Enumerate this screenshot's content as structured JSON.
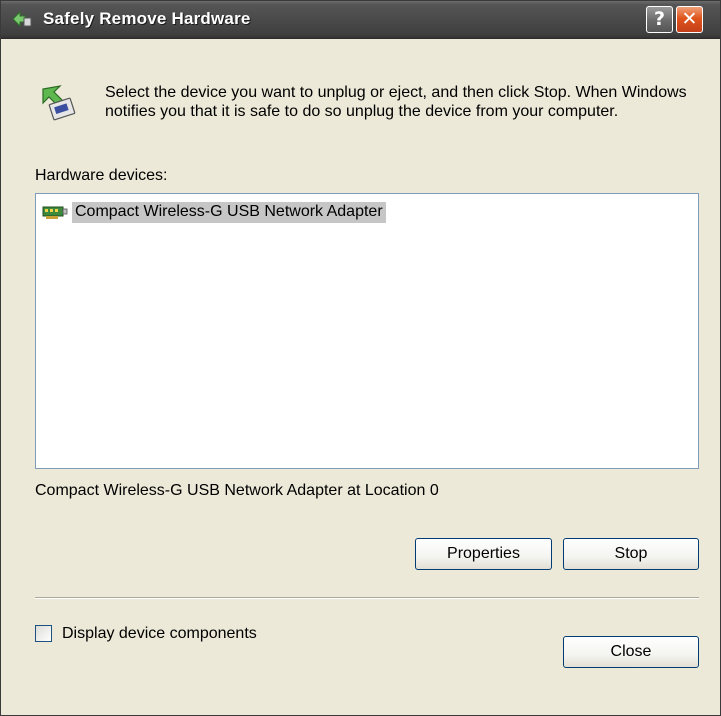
{
  "window": {
    "title": "Safely Remove Hardware",
    "help_glyph": "?",
    "close_glyph": "✕"
  },
  "instructions": "Select the device you want to unplug or eject, and then click Stop. When Windows notifies you that it is safe to do so unplug the device from your computer.",
  "devices": {
    "label": "Hardware devices:",
    "items": [
      {
        "label": "Compact Wireless-G USB Network Adapter",
        "icon": "network-adapter-icon",
        "selected": true
      }
    ],
    "selected_description": "Compact Wireless-G USB Network Adapter at Location 0"
  },
  "buttons": {
    "properties": "Properties",
    "stop": "Stop",
    "close": "Close"
  },
  "options": {
    "display_components_label": "Display device components",
    "display_components_checked": false
  },
  "colors": {
    "dialog_bg": "#ECE9D8",
    "titlebar": "#4a4a4a",
    "close_button": "#e0541c",
    "selection": "#C6C6C6",
    "list_border": "#7F9DB9"
  }
}
